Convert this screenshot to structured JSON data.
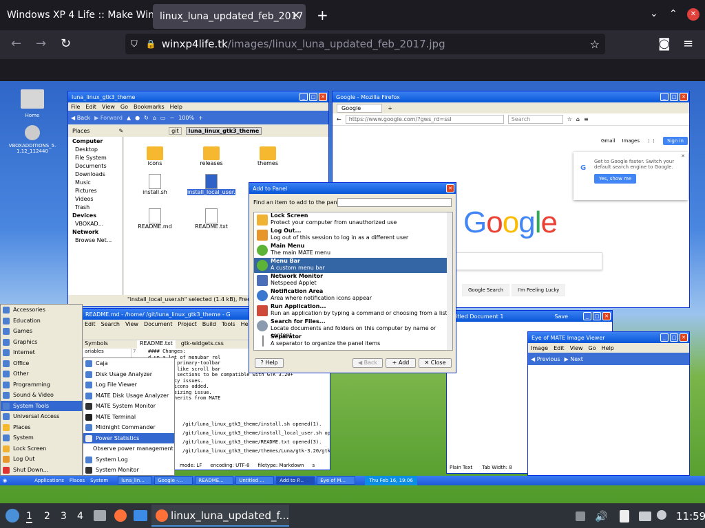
{
  "browser": {
    "tabs": [
      {
        "label": "Windows XP 4 Life :: Make Win"
      },
      {
        "label": "linux_luna_updated_feb_2017"
      }
    ],
    "url_host": "winxp4life.tk",
    "url_path": "/images/linux_luna_updated_feb_2017.jpg"
  },
  "desktop": {
    "icons": [
      {
        "label": "Home"
      },
      {
        "label": "VBOXADDITIONS_5.1.12_112440"
      }
    ]
  },
  "caja": {
    "title": "luna_linux_gtk3_theme",
    "menu": [
      "File",
      "Edit",
      "View",
      "Go",
      "Bookmarks",
      "Help"
    ],
    "back": "Back",
    "forward": "Forward",
    "zoom": "100%",
    "places_label": "Places",
    "path": [
      "git",
      "luna_linux_gtk3_theme"
    ],
    "sidebar": [
      "Computer",
      "Desktop",
      "File System",
      "Documents",
      "Downloads",
      "Music",
      "Pictures",
      "Videos",
      "Trash",
      "Devices",
      "VBOXAD...",
      "Network",
      "Browse Net..."
    ],
    "files": [
      "icons",
      "releases",
      "themes",
      "install.sh",
      "install_local_user.sh",
      "README.md",
      "README.txt"
    ],
    "status": "\"install_local_user.sh\" selected (1.4 kB), Free spa"
  },
  "firefox": {
    "title": "Google - Mozilla Firefox",
    "tab": "Google",
    "url": "https://www.google.com/?gws_rd=ssl",
    "search_placeholder": "Search",
    "gmail": "Gmail",
    "images": "Images",
    "signin": "Sign in",
    "popup_text": "Get to Google faster. Switch your default search engine to Google.",
    "popup_btn": "Yes, show me",
    "btn_search": "Google Search",
    "btn_lucky": "I'm Feeling Lucky"
  },
  "dialog": {
    "title": "Add to Panel",
    "find_label": "Find an item to add to the panel:",
    "items": [
      {
        "name": "Lock Screen",
        "desc": "Protect your computer from unauthorized use"
      },
      {
        "name": "Log Out...",
        "desc": "Log out of this session to log in as a different user"
      },
      {
        "name": "Main Menu",
        "desc": "The main MATE menu"
      },
      {
        "name": "Menu Bar",
        "desc": "A custom menu bar"
      },
      {
        "name": "Network Monitor",
        "desc": "Netspeed Applet"
      },
      {
        "name": "Notification Area",
        "desc": "Area where notification icons appear"
      },
      {
        "name": "Run Application...",
        "desc": "Run an application by typing a command or choosing from a list"
      },
      {
        "name": "Search for Files...",
        "desc": "Locate documents and folders on this computer by name or content"
      },
      {
        "name": "Separator",
        "desc": "A separator to organize the panel items"
      }
    ],
    "help": "Help",
    "back": "Back",
    "add": "Add",
    "close": "Close"
  },
  "editor": {
    "title": "README.md - /home/       /git/luna_linux_gtk3_theme - G",
    "menu": [
      "Edit",
      "Search",
      "View",
      "Document",
      "Project",
      "Build",
      "Tools",
      "Help"
    ],
    "sidebar_tab": "Symbols",
    "sidebar_item": "ariables",
    "tabs": [
      "README.txt",
      "gtk-widgets.css"
    ],
    "line_num": "7",
    "code": [
      "#### Changes:",
      "d up a lot of menubar rel",
      "d up some primary-toolbar",
      "better XP like scroll bar",
      "e lots of sections to be compatible with GTK 3.20+",
      "consistency issues.",
      "g system icons added.",
      "window resizing issue.",
      "et now inherits from MATE"
    ],
    "log": [
      "/git/luna_linux_gtk3_theme/install.sh opened(1).",
      "/git/luna_linux_gtk3_theme/install_local_user.sh opene",
      "/git/luna_linux_gtk3_theme/README.txt opened(3).",
      "/git/luna_linux_gtk3_theme/themes/Luna/gtk-3.20/gtk-w"
    ],
    "status": [
      "mode: LF",
      "encoding: UTF-8",
      "filetype: Markdown",
      "s"
    ]
  },
  "writer": {
    "title": "ntitled Document 1",
    "save": "Save",
    "status": [
      "Plain Text",
      "Tab Width: 8"
    ]
  },
  "eom": {
    "title": "Eye of MATE Image Viewer",
    "menu": [
      "Image",
      "Edit",
      "View",
      "Go",
      "Help"
    ],
    "prev": "Previous",
    "next": "Next"
  },
  "startmenu": {
    "categories": [
      "Accessories",
      "Education",
      "Games",
      "Graphics",
      "Internet",
      "Office",
      "Other",
      "Programming",
      "Sound & Video",
      "System Tools",
      "Universal Access",
      "Places",
      "System",
      "Lock Screen",
      "Log Out",
      "Shut Down..."
    ],
    "submenu": [
      "Caja",
      "Disk Usage Analyzer",
      "Log File Viewer",
      "MATE Disk Usage Analyzer",
      "MATE System Monitor",
      "MATE Terminal",
      "Midnight Commander",
      "Power Statistics",
      "Observe power management",
      "System Log",
      "System Monitor"
    ]
  },
  "xptaskbar": {
    "apps": "Applications",
    "places": "Places",
    "system": "System",
    "tasks": [
      "luna_lin...",
      "Google -...",
      "README...",
      "Untitled ...",
      "Add to P...",
      "Eye of M..."
    ],
    "clock": "Thu Feb 16, 19:06"
  },
  "host": {
    "workspaces": [
      "1",
      "2",
      "3",
      "4"
    ],
    "task": "linux_luna_updated_f...",
    "clock": "11:59"
  }
}
